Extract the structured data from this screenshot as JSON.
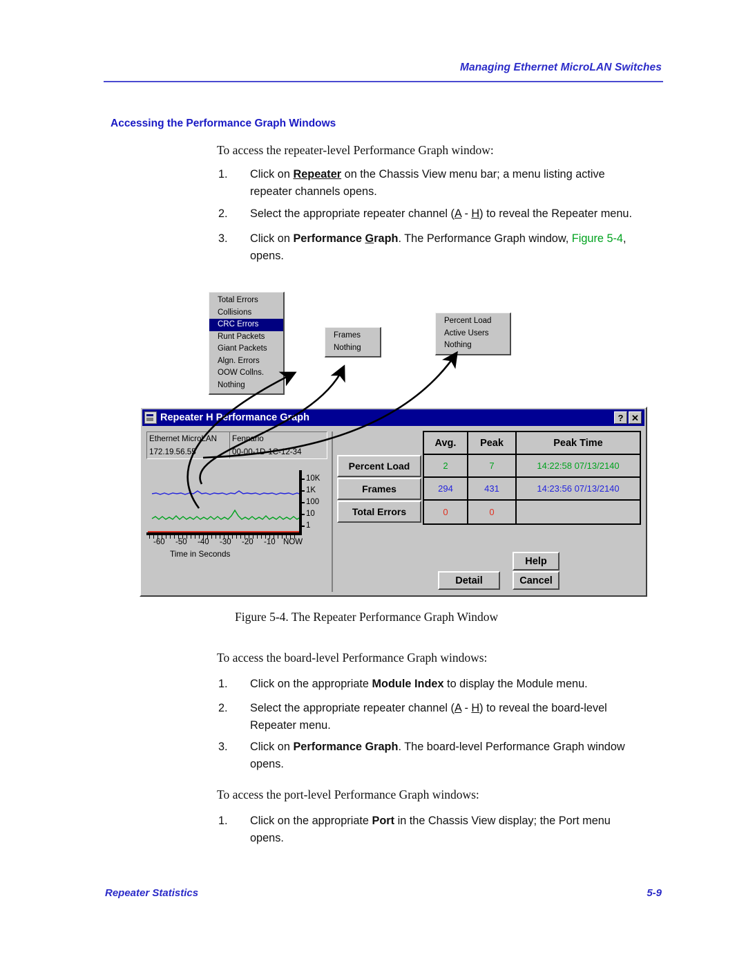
{
  "header": {
    "running_head": "Managing Ethernet MicroLAN Switches"
  },
  "section": {
    "heading": "Accessing the Performance Graph Windows"
  },
  "body": {
    "lead1": "To access the repeater-level Performance Graph window:",
    "steps1": [
      {
        "num": "1.",
        "pre": "Click on ",
        "bold": "Repeater",
        "post": " on the Chassis View menu bar; a menu listing active repeater channels opens."
      },
      {
        "num": "2.",
        "pre": "Select the appropriate repeater channel (",
        "a": "A",
        "mid": " - ",
        "h": "H",
        "post": ") to reveal the Repeater menu."
      },
      {
        "num": "3.",
        "pre": "Click on ",
        "bold": "Performance ",
        "bold_u": "G",
        "bold2": "raph",
        "post": ". The Performance Graph window, ",
        "link": "Figure 5-4",
        "tail": ", opens."
      }
    ],
    "lead2": "To access the board-level Performance Graph windows:",
    "steps2": [
      {
        "num": "1.",
        "pre": "Click on the appropriate ",
        "bold": "Module Index",
        "post": " to display the Module menu."
      },
      {
        "num": "2.",
        "pre": "Select the appropriate repeater channel (",
        "a": "A",
        "mid": " - ",
        "h": "H",
        "post": ") to reveal the board-level Repeater menu."
      },
      {
        "num": "3.",
        "pre": "Click on ",
        "bold": "Performance Graph",
        "post": ". The board-level Performance Graph window opens."
      }
    ],
    "lead3": "To access the port-level Performance Graph windows:",
    "steps3": [
      {
        "num": "1.",
        "pre": "Click on the appropriate ",
        "bold": "Port",
        "post": " in the Chassis View display; the Port menu opens."
      }
    ]
  },
  "figure": {
    "caption": "Figure 5-4.  The Repeater Performance Graph Window",
    "menus": {
      "errors": {
        "items": [
          "Total Errors",
          "Collisions",
          "CRC Errors",
          "Runt Packets",
          "Giant Packets",
          "Algn. Errors",
          "OOW Collns.",
          "Nothing"
        ],
        "selected_index": 2
      },
      "frames": {
        "items": [
          "Frames",
          "Nothing"
        ],
        "selected_index": -1
      },
      "load": {
        "items": [
          "Percent Load",
          "Active Users",
          "Nothing"
        ],
        "selected_index": -1
      }
    },
    "dialog": {
      "title": "Repeater H Performance Graph",
      "titlebar_buttons": [
        "?",
        "✕"
      ],
      "info": {
        "device_type": "Ethernet MicroLAN",
        "device_name": "Fennario",
        "ip_address": "172.19.56.55",
        "mac_address": "00-00-1D-1C-12-34"
      },
      "graph": {
        "y_labels": [
          "10K",
          "1K",
          "100",
          "10",
          "1"
        ],
        "x_labels": [
          "-60",
          "-50",
          "-40",
          "-30",
          "-20",
          "-10",
          "NOW"
        ],
        "x_caption": "Time in Seconds"
      },
      "row_buttons": [
        "Percent Load",
        "Frames",
        "Total Errors"
      ],
      "table": {
        "columns": [
          "Avg.",
          "Peak",
          "Peak Time"
        ],
        "rows": [
          {
            "avg": "2",
            "peak": "7",
            "peak_time": "14:22:58 07/13/2140",
            "color": "#00a21e"
          },
          {
            "avg": "294",
            "peak": "431",
            "peak_time": "14:23:56 07/13/2140",
            "color": "#2424dd"
          },
          {
            "avg": "0",
            "peak": "0",
            "peak_time": "",
            "color": "#e03020"
          }
        ]
      },
      "buttons": {
        "detail": "Detail",
        "help": "Help",
        "cancel": "Cancel"
      }
    }
  },
  "footer": {
    "left": "Repeater Statistics",
    "right": "5-9"
  },
  "chart_data": {
    "type": "line",
    "title": "Repeater H Performance Graph",
    "xlabel": "Time in Seconds",
    "ylabel": "",
    "x_ticks": [
      "-60",
      "-50",
      "-40",
      "-30",
      "-20",
      "-10",
      "NOW"
    ],
    "y_ticks": [
      "1",
      "10",
      "100",
      "1K",
      "10K"
    ],
    "y_scale": "log",
    "series": [
      {
        "name": "Frames",
        "color": "#2424dd",
        "approx_level": 300
      },
      {
        "name": "Percent Load",
        "color": "#00a21e",
        "approx_level": 2
      },
      {
        "name": "Total Errors",
        "color": "#e03020",
        "approx_level": 0
      }
    ]
  }
}
